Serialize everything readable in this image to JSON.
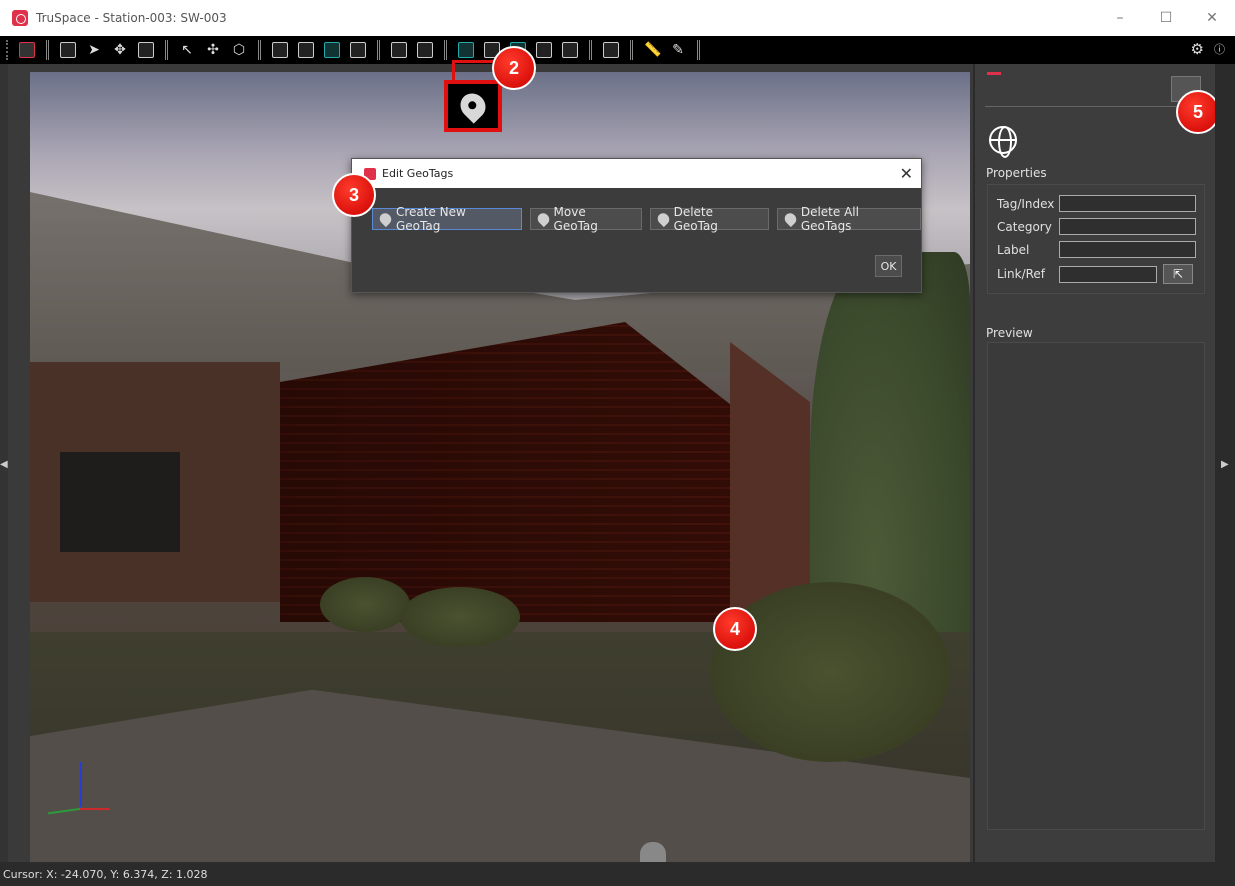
{
  "window": {
    "title": "TruSpace - Station-003: SW-003",
    "minimize": "–",
    "maximize": "☐",
    "close": "✕"
  },
  "toolbar": {
    "settings_icon": "⚙",
    "info_icon": "ⓘ"
  },
  "dialog": {
    "title": "Edit GeoTags",
    "close": "✕",
    "buttons": [
      {
        "label": "Create New GeoTag",
        "icon": "geotag-create-icon"
      },
      {
        "label": "Move GeoTag",
        "icon": "geotag-move-icon"
      },
      {
        "label": "Delete GeoTag",
        "icon": "geotag-delete-icon"
      },
      {
        "label": "Delete All GeoTags",
        "icon": "geotag-delete-all-icon"
      }
    ],
    "ok_label": "OK"
  },
  "callouts": {
    "c2": "2",
    "c3": "3",
    "c4": "4",
    "c5": "5"
  },
  "panel": {
    "properties_label": "Properties",
    "fields": {
      "tag_index": {
        "label": "Tag/Index",
        "value": ""
      },
      "category": {
        "label": "Category",
        "value": ""
      },
      "label": {
        "label": "Label",
        "value": ""
      },
      "link_ref": {
        "label": "Link/Ref",
        "value": ""
      }
    },
    "link_button_icon": "⇱",
    "preview_label": "Preview"
  },
  "status": {
    "cursor_text": "Cursor: X: -24.070, Y: 6.374, Z: 1.028"
  },
  "colors": {
    "accent": "#e0314b",
    "callout_red": "#e01010",
    "panel_bg": "#3d3d3d",
    "toolbar_bg": "#000000"
  }
}
